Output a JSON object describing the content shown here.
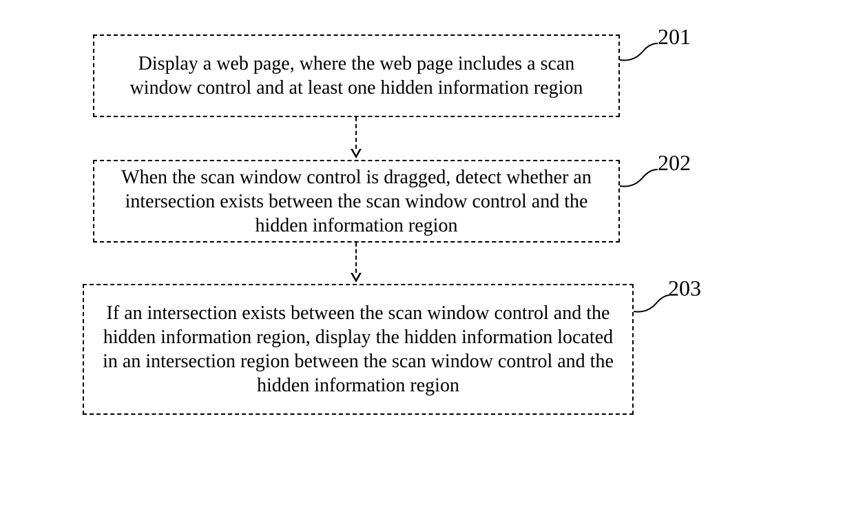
{
  "steps": [
    {
      "label": "201",
      "text": "Display a web page, where the web page includes a scan window control and at least one hidden information region"
    },
    {
      "label": "202",
      "text": "When the scan window control is dragged, detect whether an intersection exists between the scan window control and the hidden information region"
    },
    {
      "label": "203",
      "text": "If an intersection exists between the scan window control and the hidden information region, display the hidden information located in an intersection region between the scan window control and the hidden information region"
    }
  ]
}
